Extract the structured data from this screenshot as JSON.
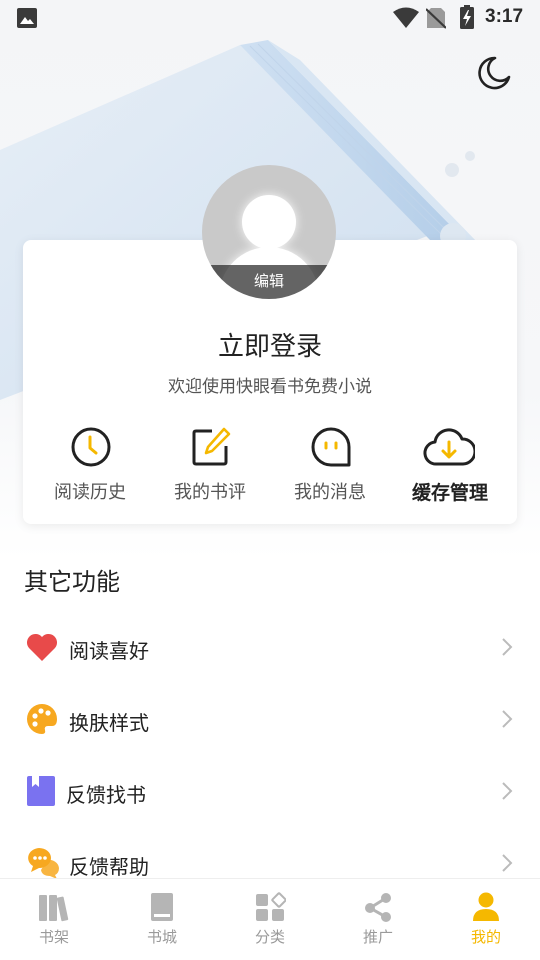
{
  "status_bar": {
    "time": "3:17"
  },
  "profile": {
    "edit_label": "编辑",
    "login_title": "立即登录",
    "login_subtitle": "欢迎使用快眼看书免费小说"
  },
  "quick_actions": [
    {
      "label": "阅读历史",
      "icon": "clock-icon"
    },
    {
      "label": "我的书评",
      "icon": "edit-note-icon"
    },
    {
      "label": "我的消息",
      "icon": "message-bubble-icon"
    },
    {
      "label": "缓存管理",
      "icon": "cloud-download-icon"
    }
  ],
  "other_functions": {
    "title": "其它功能",
    "items": [
      {
        "label": "阅读喜好",
        "icon": "heart-icon"
      },
      {
        "label": "换肤样式",
        "icon": "palette-icon"
      },
      {
        "label": "反馈找书",
        "icon": "bookmark-book-icon"
      },
      {
        "label": "反馈帮助",
        "icon": "chat-bubbles-icon"
      }
    ]
  },
  "tabs": [
    {
      "label": "书架",
      "icon": "bookshelf-icon",
      "active": false
    },
    {
      "label": "书城",
      "icon": "book-icon",
      "active": false
    },
    {
      "label": "分类",
      "icon": "category-grid-icon",
      "active": false
    },
    {
      "label": "推广",
      "icon": "share-icon",
      "active": false
    },
    {
      "label": "我的",
      "icon": "person-icon",
      "active": true
    }
  ],
  "colors": {
    "accent": "#f5b800",
    "heart": "#e84a4a",
    "palette": "#f7a820",
    "book": "#7a72f0",
    "tab_inactive": "#9a9a9a"
  }
}
